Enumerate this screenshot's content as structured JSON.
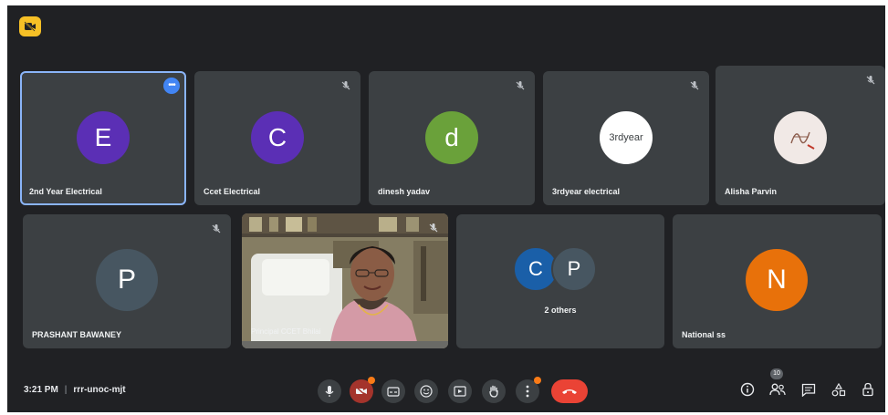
{
  "top_badge_icon": "video-off-icon",
  "participants": [
    {
      "name": "2nd Year Electrical",
      "initial": "E",
      "color": "#5b2fb5",
      "active": true,
      "muted": false
    },
    {
      "name": "Ccet Electrical",
      "initial": "C",
      "color": "#5b2fb5",
      "muted": true
    },
    {
      "name": "dinesh yadav",
      "initial": "d",
      "color": "#6aa13a",
      "muted": true
    },
    {
      "name": "3rdyear electrical",
      "initial": "3rdyear",
      "color": "#ffffff",
      "muted": true
    },
    {
      "name": "Alisha Parvin",
      "initial": "",
      "color": "#f1e9e6",
      "muted": true
    },
    {
      "name": "PRASHANT BAWANEY",
      "initial": "P",
      "color": "#475661",
      "muted": true
    },
    {
      "name": "Principal CCET Bhilai",
      "video": true,
      "muted": true
    },
    {
      "others_label": "2 others",
      "avatars": [
        {
          "initial": "C",
          "color": "#1a5fa8"
        },
        {
          "initial": "P",
          "color": "#475661"
        }
      ]
    },
    {
      "name": "National ss",
      "initial": "N",
      "color": "#e8710a",
      "muted": false
    }
  ],
  "bottom_bar": {
    "time": "3:21 PM",
    "separator": "|",
    "meeting_code": "rrr-unoc-mjt",
    "participant_count": "10",
    "controls": [
      "microphone-icon",
      "camera-off-icon",
      "captions-icon",
      "emoji-icon",
      "present-icon",
      "raise-hand-icon",
      "more-options-icon",
      "end-call-icon"
    ],
    "side": [
      "info-icon",
      "people-icon",
      "chat-icon",
      "activities-icon",
      "host-controls-icon"
    ]
  }
}
